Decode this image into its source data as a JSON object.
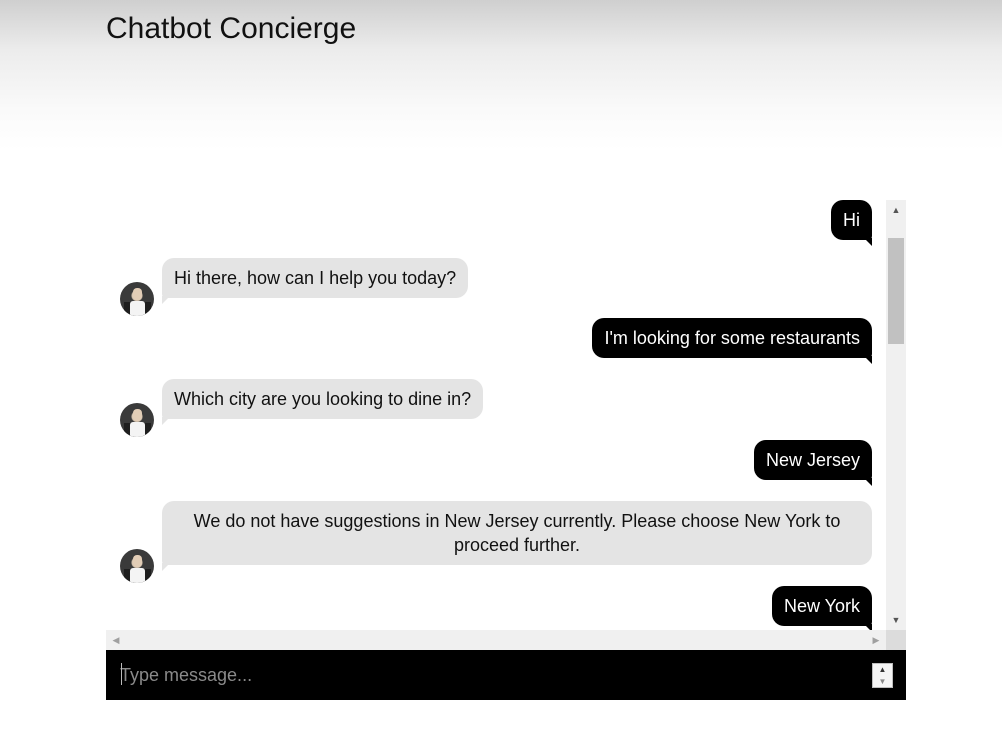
{
  "app": {
    "title": "Chatbot Concierge"
  },
  "messages": [
    {
      "role": "user",
      "text": "Hi"
    },
    {
      "role": "bot",
      "text": "Hi there, how can I help you today?"
    },
    {
      "role": "user",
      "text": "I'm looking for some restaurants"
    },
    {
      "role": "bot",
      "text": "Which city are you looking to dine in?"
    },
    {
      "role": "user",
      "text": "New Jersey"
    },
    {
      "role": "bot",
      "text": "We do not have suggestions in New Jersey currently. Please choose New York to proceed further."
    },
    {
      "role": "user",
      "text": "New York"
    }
  ],
  "input": {
    "placeholder": "Type message..."
  },
  "icons": {
    "scroll_up": "triangle-up-icon",
    "scroll_down": "triangle-down-icon",
    "scroll_left": "triangle-left-icon",
    "scroll_right": "triangle-right-icon",
    "avatar": "bot-avatar"
  },
  "colors": {
    "user_bubble": "#000000",
    "bot_bubble": "#e4e4e4",
    "input_bar": "#000000"
  }
}
